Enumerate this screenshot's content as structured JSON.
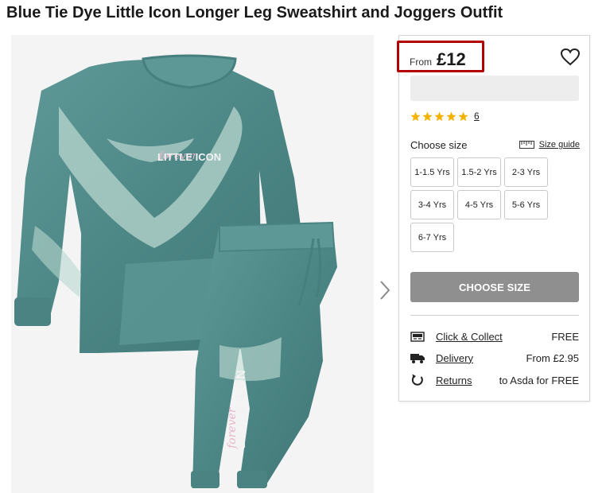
{
  "product": {
    "title": "Blue Tie Dye Little Icon Longer Leg Sweatshirt and Joggers Outfit",
    "image_print_text": "LITTLE ICON",
    "image_print_script": "forever"
  },
  "gallery": {
    "next_icon": "chevron-right-icon"
  },
  "price": {
    "from_label": "From",
    "value": "£12",
    "highlight_color": "#b30000"
  },
  "wishlist": {
    "icon": "heart-outline-icon"
  },
  "rating": {
    "stars": 5,
    "star_color": "#f5b301",
    "review_count": "6"
  },
  "size": {
    "choose_label": "Choose size",
    "guide_label": "Size guide",
    "guide_icon": "ruler-icon",
    "options": [
      "1-1.5 Yrs",
      "1.5-2 Yrs",
      "2-3 Yrs",
      "3-4 Yrs",
      "4-5 Yrs",
      "5-6 Yrs",
      "6-7 Yrs"
    ]
  },
  "cta": {
    "label": "CHOOSE SIZE",
    "color": "#8f8f8f"
  },
  "delivery": [
    {
      "icon": "store-icon",
      "label": "Click & Collect",
      "value": "FREE"
    },
    {
      "icon": "truck-icon",
      "label": "Delivery",
      "value": "From £2.95"
    },
    {
      "icon": "returns-icon",
      "label": "Returns",
      "value": "to Asda for FREE"
    }
  ]
}
